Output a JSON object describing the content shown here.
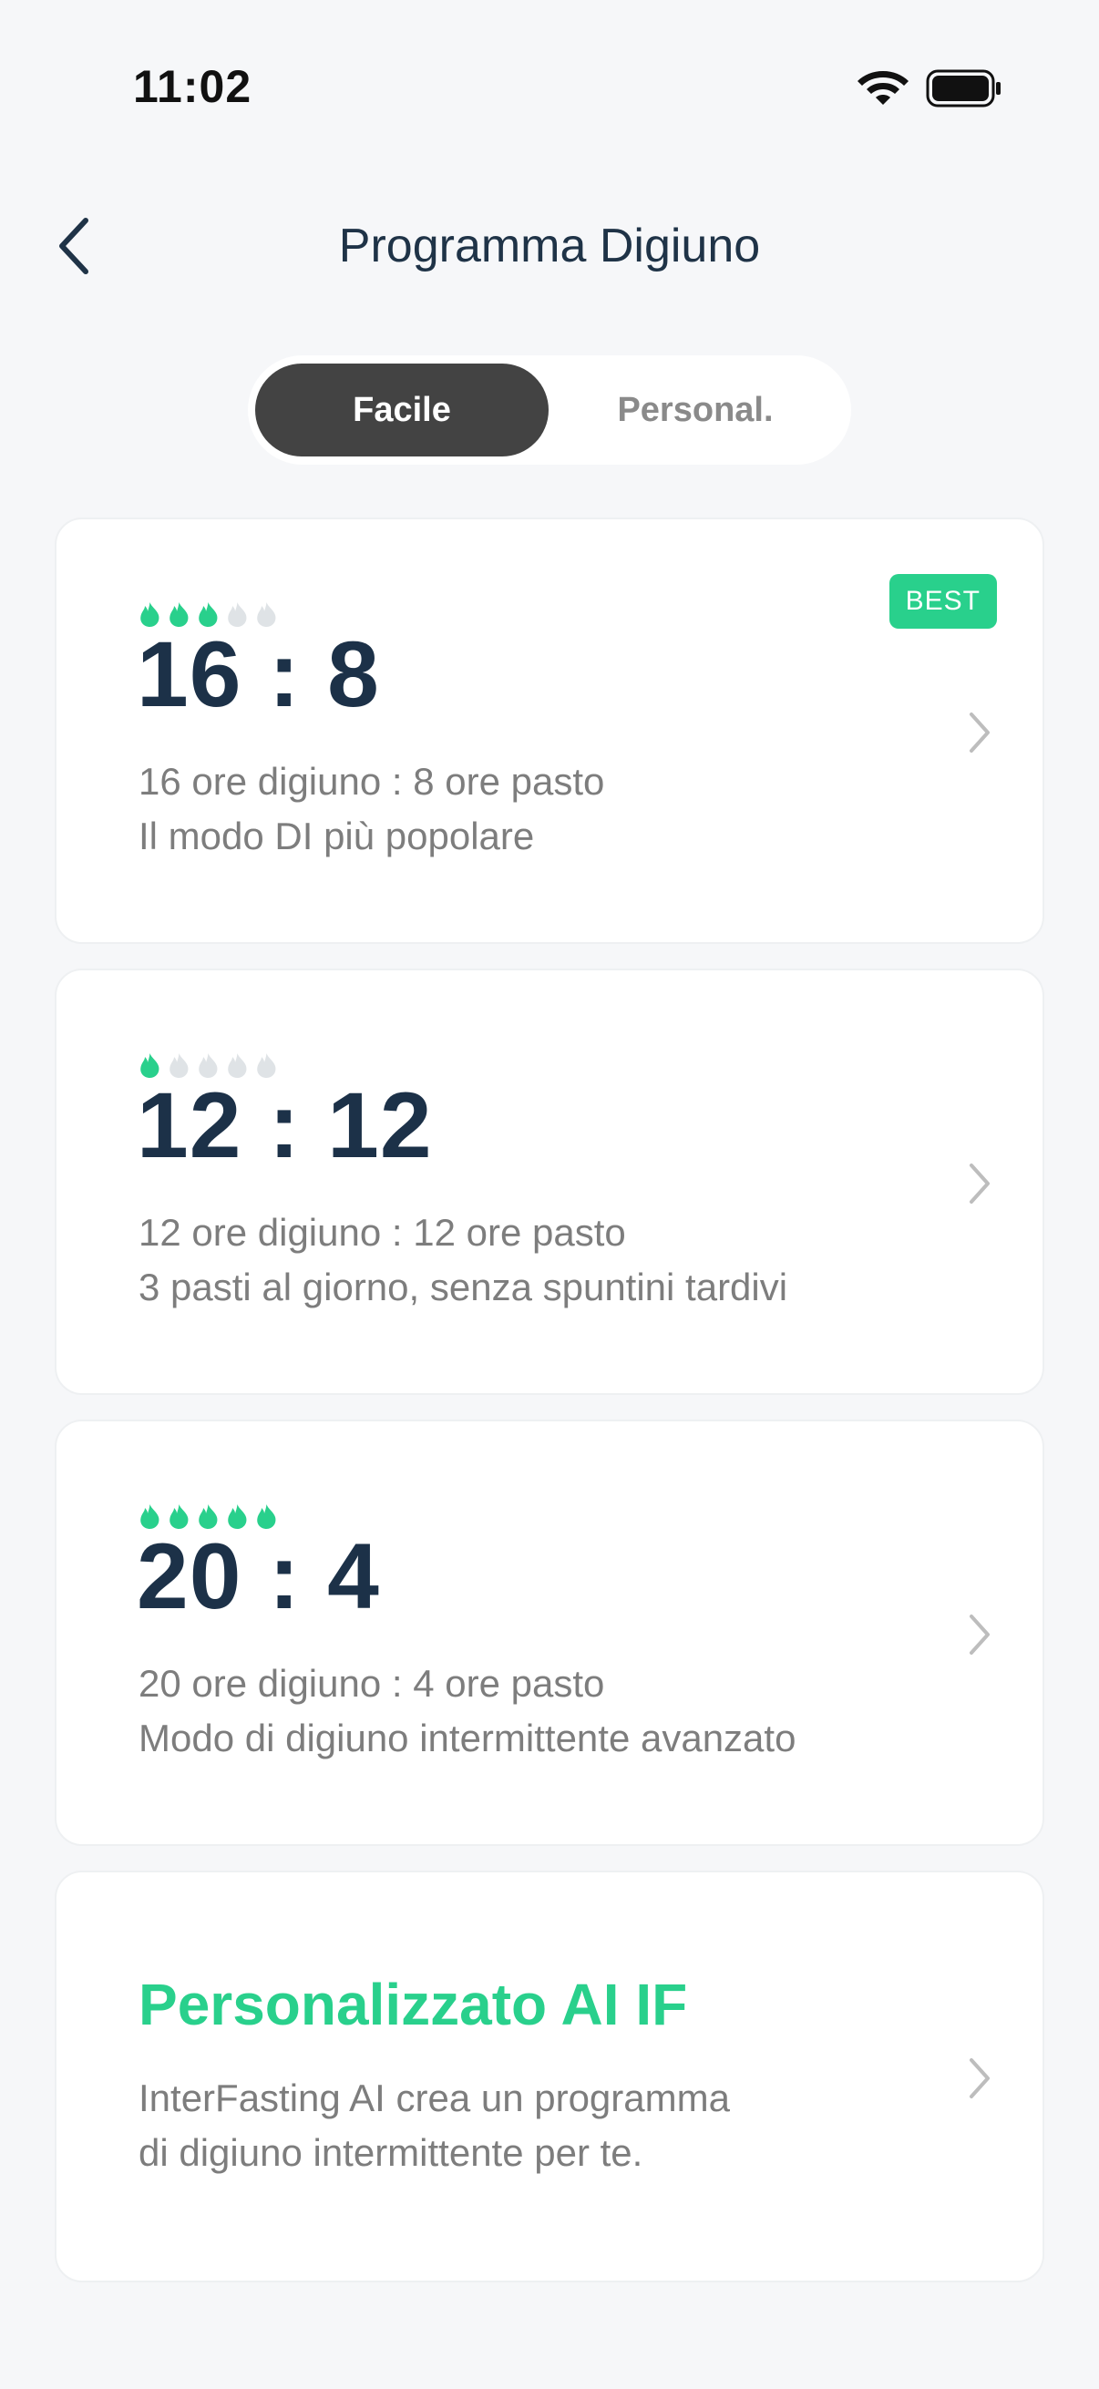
{
  "status_bar": {
    "time": "11:02",
    "wifi_icon": "wifi-icon",
    "battery_icon": "battery-icon"
  },
  "header": {
    "title": "Programma Digiuno",
    "back_icon": "chevron-left-icon"
  },
  "tabs": [
    {
      "label": "Facile",
      "selected": true
    },
    {
      "label": "Personal.",
      "selected": false
    }
  ],
  "plans": [
    {
      "ratio": "16 : 8",
      "difficulty": 3,
      "max_difficulty": 5,
      "line1": "16 ore digiuno : 8 ore pasto",
      "line2": "Il modo DI più popolare",
      "badge": "BEST"
    },
    {
      "ratio": "12 : 12",
      "difficulty": 1,
      "max_difficulty": 5,
      "line1": "12 ore digiuno : 12 ore pasto",
      "line2": "3 pasti al giorno, senza spuntini tardivi"
    },
    {
      "ratio": "20 : 4",
      "difficulty": 5,
      "max_difficulty": 5,
      "line1": "20 ore digiuno : 4 ore pasto",
      "line2": "Modo di digiuno intermittente avanzato"
    }
  ],
  "ai_card": {
    "title": "Personalizzato AI IF",
    "line1": "InterFasting AI crea un programma",
    "line2": "di digiuno intermittente per te."
  },
  "colors": {
    "accent": "#29d08c",
    "flame_off": "#dfe3e6",
    "ratio_text": "#1c3148",
    "tab_active": "#434343",
    "background": "#f6f7f9"
  },
  "icons": {
    "flame": "flame-icon",
    "chevron": "chevron-right-icon"
  }
}
